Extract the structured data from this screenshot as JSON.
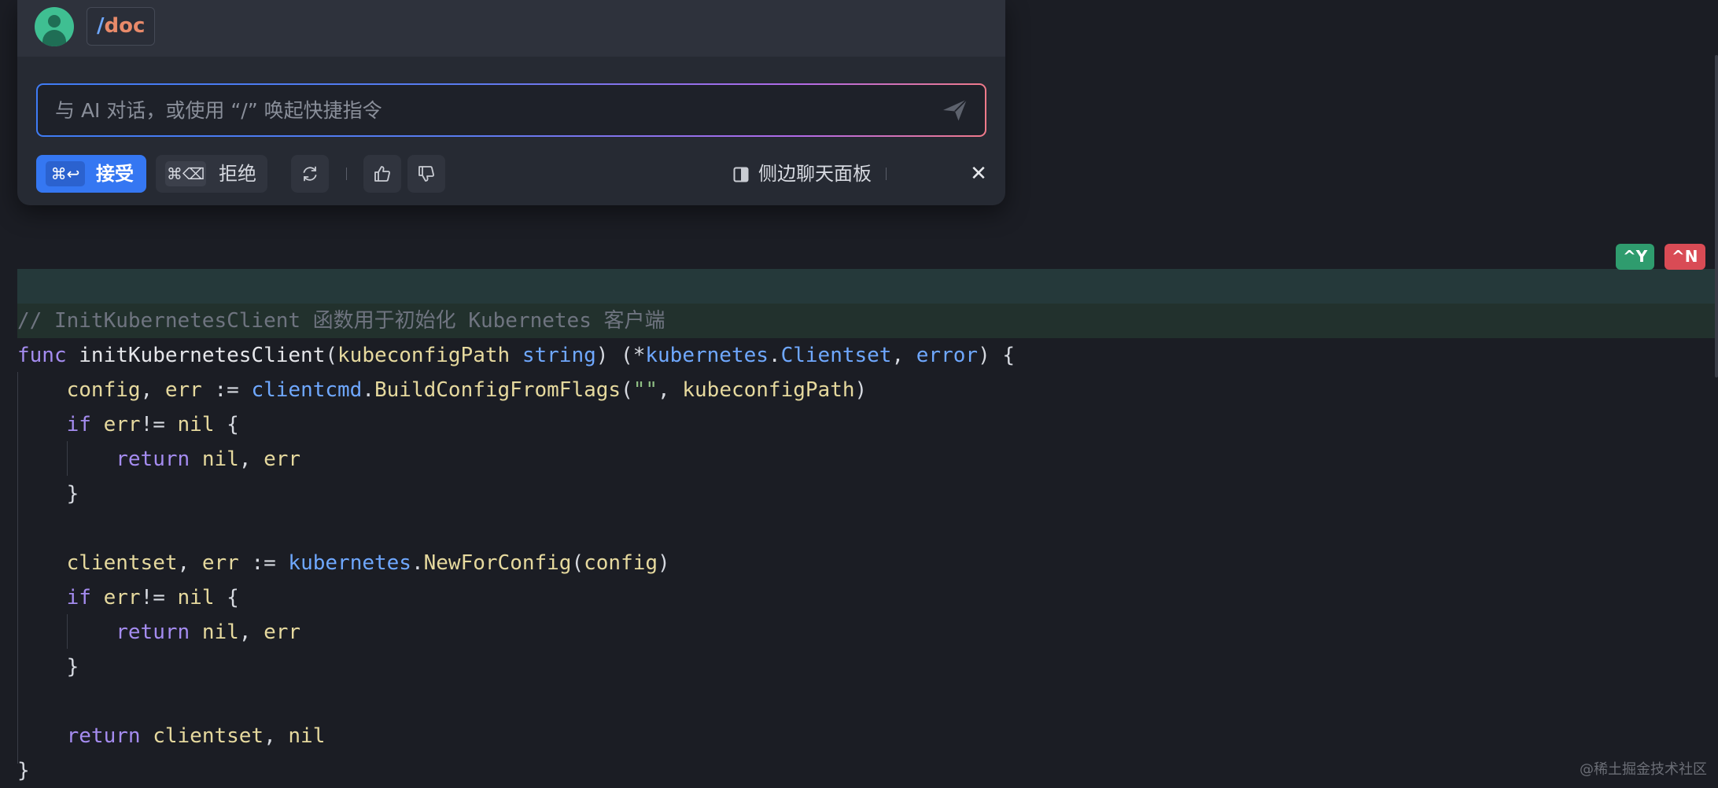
{
  "ai_panel": {
    "command_prefix": "/",
    "command_name": "doc",
    "input_placeholder": "与 AI 对话，或使用 “/” 唤起快捷指令",
    "input_value": "",
    "accept": {
      "shortcut": "⌘↩",
      "label": "接受"
    },
    "reject": {
      "shortcut": "⌘⌫",
      "label": "拒绝"
    },
    "side_panel_label": "侧边聊天面板",
    "close_symbol": "✕"
  },
  "diff_badges": {
    "accept": "^Y",
    "reject": "^N"
  },
  "code": {
    "comment": "// InitKubernetesClient 函数用于初始化 Kubernetes 客户端",
    "lines": [
      "func initKubernetesClient(kubeconfigPath string) (*kubernetes.Clientset, error) {",
      "    config, err := clientcmd.BuildConfigFromFlags(\"\", kubeconfigPath)",
      "    if err!= nil {",
      "        return nil, err",
      "    }",
      "",
      "    clientset, err := kubernetes.NewForConfig(config)",
      "    if err!= nil {",
      "        return nil, err",
      "    }",
      "",
      "    return clientset, nil",
      "}"
    ]
  },
  "watermark": "@稀土掘金技术社区",
  "colors": {
    "accent": "#3577f2",
    "accept_badge": "#2f9c6e",
    "reject_badge": "#d94b55",
    "added_line_bg": "#22312d"
  },
  "icons": [
    "user-avatar-icon",
    "send-icon",
    "refresh-icon",
    "thumbs-up-icon",
    "thumbs-down-icon",
    "side-panel-icon",
    "close-icon"
  ]
}
